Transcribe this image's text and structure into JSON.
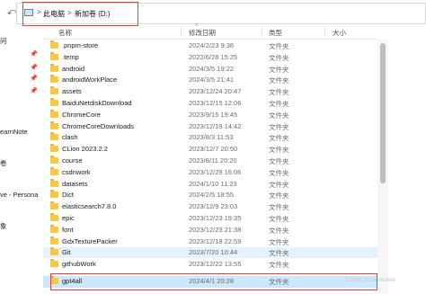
{
  "address_bar": {
    "crumbs": [
      "此电脑",
      "新加卷 (D:)"
    ],
    "separator": ">"
  },
  "nav": {
    "items": [
      "问",
      "earnNote",
      "卷",
      "ve - Persona",
      "象"
    ]
  },
  "columns": {
    "name": "名称",
    "date": "修改日期",
    "type": "类型",
    "size": "大小"
  },
  "rows": [
    {
      "name": ".pnpm-store",
      "date": "2024/2/23 9:36",
      "type": "文件夹"
    },
    {
      "name": ".temp",
      "date": "2022/6/28 15:25",
      "type": "文件夹"
    },
    {
      "name": "android",
      "date": "2024/3/5 19:22",
      "type": "文件夹"
    },
    {
      "name": "androidWorkPlace",
      "date": "2024/3/5 21:41",
      "type": "文件夹"
    },
    {
      "name": "assets",
      "date": "2023/12/24 20:47",
      "type": "文件夹"
    },
    {
      "name": "BaiduNetdiskDownload",
      "date": "2023/12/15 12:06",
      "type": "文件夹"
    },
    {
      "name": "ChromeCore",
      "date": "2023/9/15 19:45",
      "type": "文件夹"
    },
    {
      "name": "ChromeCoreDownloads",
      "date": "2023/12/19 14:42",
      "type": "文件夹"
    },
    {
      "name": "clash",
      "date": "2023/8/3 11:53",
      "type": "文件夹"
    },
    {
      "name": "CLion 2023.2.2",
      "date": "2023/12/7 20:50",
      "type": "文件夹"
    },
    {
      "name": "course",
      "date": "2023/8/11 20:20",
      "type": "文件夹"
    },
    {
      "name": "csdnwork",
      "date": "2023/12/29 16:06",
      "type": "文件夹"
    },
    {
      "name": "datasets",
      "date": "2024/1/10 11:23",
      "type": "文件夹"
    },
    {
      "name": "Dict",
      "date": "2024/2/5 18:55",
      "type": "文件夹"
    },
    {
      "name": "elasticsearch7.8.0",
      "date": "2023/12/9 23:03",
      "type": "文件夹"
    },
    {
      "name": "epic",
      "date": "2023/12/23 19:35",
      "type": "文件夹"
    },
    {
      "name": "font",
      "date": "2023/12/23 21:38",
      "type": "文件夹"
    },
    {
      "name": "GdxTexturePacker",
      "date": "2023/12/18 22:59",
      "type": "文件夹"
    },
    {
      "name": "Git",
      "date": "2023/7/20 10:44",
      "type": "文件夹"
    },
    {
      "name": "githubWork",
      "date": "2023/12/22 13:55",
      "type": "文件夹"
    },
    {
      "name": "gpt4all",
      "date": "2024/4/1 20:28",
      "type": "文件夹"
    }
  ],
  "watermark": "CSDN @nanshaws"
}
